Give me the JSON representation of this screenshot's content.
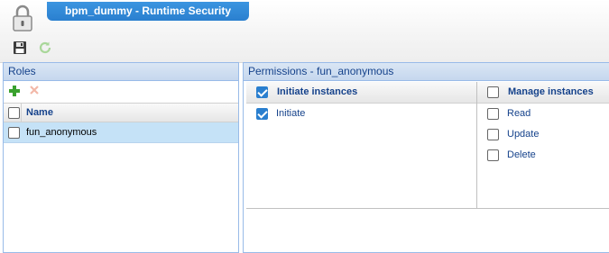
{
  "window": {
    "title": "bpm_dummy - Runtime Security",
    "lock_icon": "lock-icon",
    "toolbar": [
      {
        "icon": "save-icon"
      },
      {
        "icon": "refresh-icon"
      }
    ]
  },
  "roles": {
    "header": "Roles",
    "toolbar": {
      "add_icon": "add-icon",
      "delete_icon": "delete-icon"
    },
    "column_header": "Name",
    "items": [
      {
        "label": "fun_anonymous",
        "selected": true,
        "checked": false
      }
    ]
  },
  "permissions": {
    "header": "Permissions - fun_anonymous",
    "groups": [
      {
        "title": "Initiate instances",
        "checked": true,
        "items": [
          {
            "label": "Initiate",
            "checked": true
          }
        ]
      },
      {
        "title": "Manage instances",
        "checked": false,
        "items": [
          {
            "label": "Read",
            "checked": false
          },
          {
            "label": "Update",
            "checked": false
          },
          {
            "label": "Delete",
            "checked": false
          }
        ]
      }
    ]
  },
  "colors": {
    "accent": "#2a7fcf",
    "panel_border": "#99bbe8",
    "selected_row": "#c5e2f7",
    "text_blue": "#15428b"
  }
}
